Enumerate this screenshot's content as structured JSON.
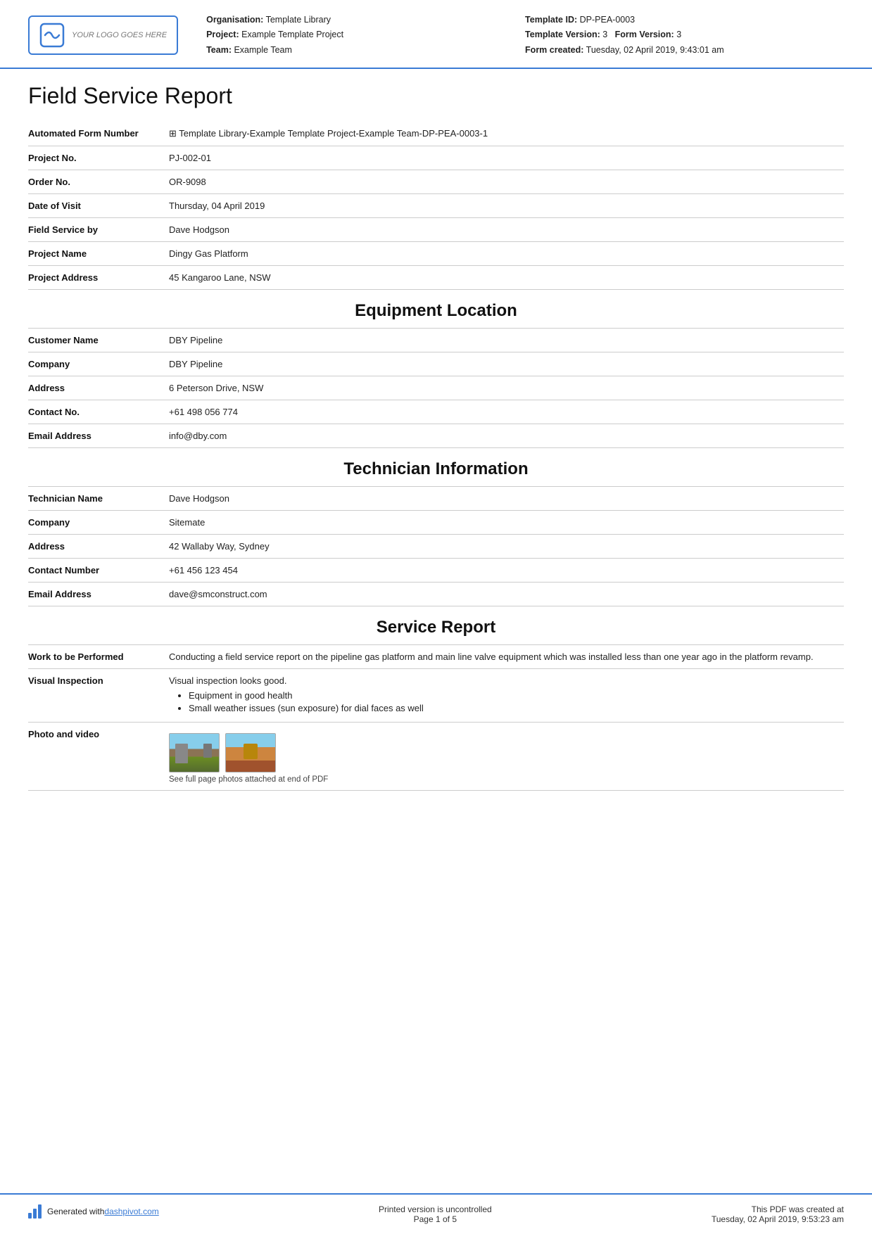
{
  "header": {
    "logo_text": "YOUR LOGO GOES HERE",
    "org_label": "Organisation:",
    "org_value": "Template Library",
    "project_label": "Project:",
    "project_value": "Example Template Project",
    "team_label": "Team:",
    "team_value": "Example Team",
    "template_id_label": "Template ID:",
    "template_id_value": "DP-PEA-0003",
    "template_version_label": "Template Version:",
    "template_version_value": "3",
    "form_version_label": "Form Version:",
    "form_version_value": "3",
    "form_created_label": "Form created:",
    "form_created_value": "Tuesday, 02 April 2019, 9:43:01 am"
  },
  "page_title": "Field Service Report",
  "fields": [
    {
      "label": "Automated Form Number",
      "value": "⊞ Template Library-Example Template Project-Example Team-DP-PEA-0003-1"
    },
    {
      "label": "Project No.",
      "value": "PJ-002-01"
    },
    {
      "label": "Order No.",
      "value": "OR-9098"
    },
    {
      "label": "Date of Visit",
      "value": "Thursday, 04 April 2019"
    },
    {
      "label": "Field Service by",
      "value": "Dave Hodgson"
    },
    {
      "label": "Project Name",
      "value": "Dingy Gas Platform"
    },
    {
      "label": "Project Address",
      "value": "45 Kangaroo Lane, NSW"
    }
  ],
  "sections": [
    {
      "title": "Equipment Location",
      "fields": [
        {
          "label": "Customer Name",
          "value": "DBY Pipeline"
        },
        {
          "label": "Company",
          "value": "DBY Pipeline"
        },
        {
          "label": "Address",
          "value": "6 Peterson Drive, NSW"
        },
        {
          "label": "Contact No.",
          "value": "+61 498 056 774"
        },
        {
          "label": "Email Address",
          "value": "info@dby.com"
        }
      ]
    },
    {
      "title": "Technician Information",
      "fields": [
        {
          "label": "Technician Name",
          "value": "Dave Hodgson"
        },
        {
          "label": "Company",
          "value": "Sitemate"
        },
        {
          "label": "Address",
          "value": "42 Wallaby Way, Sydney"
        },
        {
          "label": "Contact Number",
          "value": "+61 456 123 454"
        },
        {
          "label": "Email Address",
          "value": "dave@smconstruct.com"
        }
      ]
    },
    {
      "title": "Service Report",
      "fields": [
        {
          "label": "Work to be Performed",
          "value": "Conducting a field service report on the pipeline gas platform and main line valve equipment which was installed less than one year ago in the platform revamp.",
          "type": "text"
        },
        {
          "label": "Visual Inspection",
          "value": "Visual inspection looks good.",
          "bullets": [
            "Equipment in good health",
            "Small weather issues (sun exposure) for dial faces as well"
          ],
          "type": "bullets"
        },
        {
          "label": "Photo and video",
          "caption": "See full page photos attached at end of PDF",
          "type": "photos"
        }
      ]
    }
  ],
  "footer": {
    "generated_text": "Generated with ",
    "link_text": "dashpivot.com",
    "uncontrolled_text": "Printed version is uncontrolled",
    "page_text": "Page 1 of 5",
    "pdf_created_label": "This PDF was created at",
    "pdf_created_value": "Tuesday, 02 April 2019, 9:53:23 am"
  }
}
